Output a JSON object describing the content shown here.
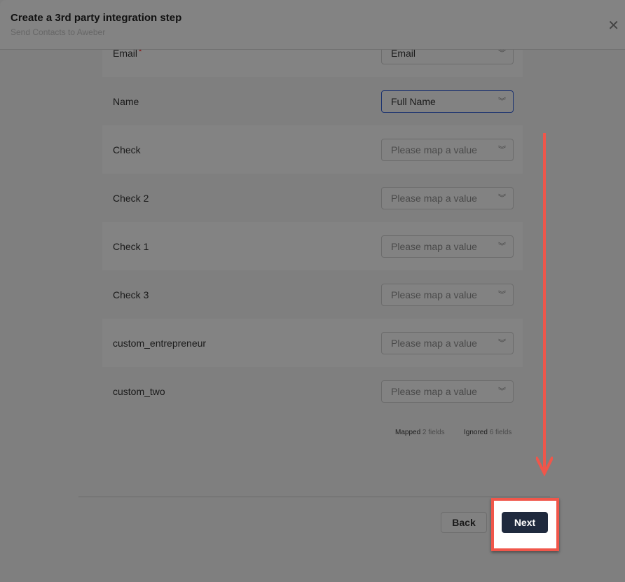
{
  "header": {
    "title": "Create a 3rd party integration step",
    "subtitle": "Send Contacts to Aweber",
    "close_icon": "close-icon"
  },
  "fields": [
    {
      "label": "Email",
      "required": "*",
      "value": "Email",
      "placeholder": false
    },
    {
      "label": "Name",
      "value": "Full Name",
      "placeholder": false,
      "focused": true
    },
    {
      "label": "Check",
      "value": "Please map a value",
      "placeholder": true
    },
    {
      "label": "Check 2",
      "value": "Please map a value",
      "placeholder": true
    },
    {
      "label": "Check 1",
      "value": "Please map a value",
      "placeholder": true
    },
    {
      "label": "Check 3",
      "value": "Please map a value",
      "placeholder": true
    },
    {
      "label": "custom_entrepreneur",
      "value": "Please map a value",
      "placeholder": true
    },
    {
      "label": "custom_two",
      "value": "Please map a value",
      "placeholder": true
    }
  ],
  "stats": {
    "mapped_label": "Mapped",
    "mapped_count": "2 fields",
    "ignored_label": "Ignored",
    "ignored_count": "6 fields"
  },
  "footer": {
    "back_label": "Back",
    "next_label": "Next"
  },
  "colors": {
    "annotation": "#f0564a",
    "primary": "#1f2a3e"
  }
}
